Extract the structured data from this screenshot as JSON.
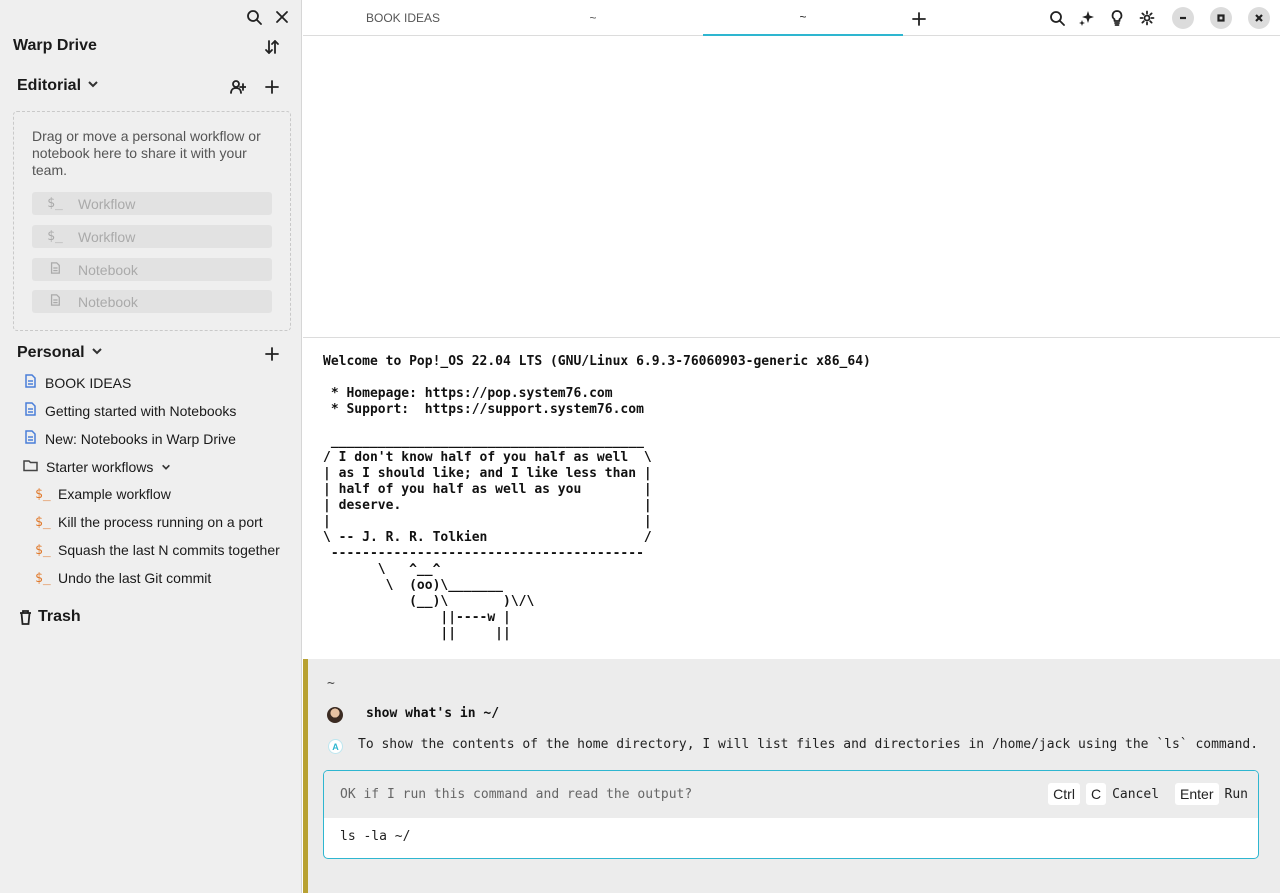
{
  "sidebar": {
    "title": "Warp Drive",
    "editorial": {
      "label": "Editorial",
      "drop_text": "Drag or move a personal workflow or notebook here to share it with your team.",
      "placeholders": [
        {
          "icon": "$_",
          "label": "Workflow"
        },
        {
          "icon": "notebook-icon",
          "label": "Workflow"
        },
        {
          "icon": "notebook-icon",
          "label": "Notebook"
        },
        {
          "icon": "notebook-icon",
          "label": "Notebook"
        }
      ],
      "ph_prompt": "$_"
    },
    "personal": {
      "label": "Personal",
      "items": [
        {
          "label": "BOOK IDEAS"
        },
        {
          "label": "Getting started with Notebooks"
        },
        {
          "label": "New: Notebooks in Warp Drive"
        },
        {
          "label": "Starter workflows"
        },
        {
          "label": "Example workflow"
        },
        {
          "label": "Kill the process running on a port"
        },
        {
          "label": "Squash the last N commits together"
        },
        {
          "label": "Undo the last Git commit"
        }
      ],
      "workflow_icon": "$_"
    },
    "trash": "Trash"
  },
  "tabs": [
    {
      "label": "BOOK IDEAS"
    },
    {
      "label": "~"
    },
    {
      "label": "~"
    }
  ],
  "terminal": {
    "welcome": "Welcome to Pop!_OS 22.04 LTS (GNU/Linux 6.9.3-76060903-generic x86_64)",
    "homepage": " * Homepage: https://pop.system76.com",
    "support": " * Support:  https://support.system76.com",
    "cowsay": [
      " ________________________________________",
      "/ I don't know half of you half as well  \\",
      "| as I should like; and I like less than |",
      "| half of you half as well as you        |",
      "| deserve.                               |",
      "|                                        |",
      "\\ -- J. R. R. Tolkien                    /",
      " ----------------------------------------",
      "       \\   ^__^",
      "        \\  (oo)\\_______",
      "           (__)\\       )\\/\\",
      "               ||----w |",
      "               ||     ||"
    ]
  },
  "ai": {
    "cwd": "~",
    "query": "show what's in ~/",
    "response": "To show the contents of the home directory, I will list files and directories in /home/jack using the `ls` command.",
    "confirm_question": "OK if I run this command and read the output?",
    "keys": {
      "ctrl": "Ctrl",
      "c": "C",
      "cancel": "Cancel",
      "enter": "Enter",
      "run": "Run"
    },
    "command": "ls -la ~/"
  },
  "colors": {
    "accent": "#2eb6d0",
    "ai_bar": "#b8a132",
    "workflow": "#e0782a",
    "notebook": "#4a7fd9"
  }
}
